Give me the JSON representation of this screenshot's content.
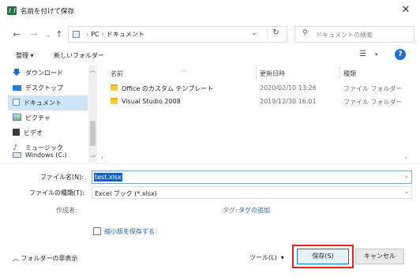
{
  "window": {
    "title": "名前を付けて保存",
    "close_glyph": "✕"
  },
  "address": {
    "breadcrumb": [
      "PC",
      "ドキュメント"
    ],
    "separator": "›",
    "search_placeholder": "ドキュメントの検索"
  },
  "toolbar": {
    "organize_label": "整理 ▾",
    "new_folder_label": "新しいフォルダー",
    "view_glyph": "☰",
    "help_glyph": "?"
  },
  "nav_pane": {
    "items": [
      {
        "label": "ダウンロード",
        "icon": "download-icon",
        "selected": false
      },
      {
        "label": "デスクトップ",
        "icon": "desktop-icon",
        "selected": false
      },
      {
        "label": "ドキュメント",
        "icon": "documents-icon",
        "selected": true
      },
      {
        "label": "ピクチャ",
        "icon": "pictures-icon",
        "selected": false
      },
      {
        "label": "ビデオ",
        "icon": "videos-icon",
        "selected": false
      },
      {
        "label": "ミュージック",
        "icon": "music-icon",
        "selected": false
      },
      {
        "label": "Windows (C:)",
        "icon": "drive-icon",
        "selected": false
      }
    ]
  },
  "file_list": {
    "columns": {
      "name": "名前",
      "date": "更新日時",
      "type": "種類"
    },
    "rows": [
      {
        "name": "Office のカスタム テンプレート",
        "date": "2020/02/10 13:26",
        "type": "ファイル フォルダー"
      },
      {
        "name": "Visual Studio 2008",
        "date": "2019/12/30 16:01",
        "type": "ファイル フォルダー"
      }
    ]
  },
  "form": {
    "filename_label": "ファイル名(N):",
    "filename_value": "test.xlsx",
    "filetype_label": "ファイルの種類(T):",
    "filetype_value": "Excel ブック (*.xlsx)",
    "author_label": "作成者:",
    "tags_label": "タグ:",
    "tags_link": "タグの追加",
    "thumbnail_label": "縮小版を保存する"
  },
  "footer": {
    "hide_folders_label": "フォルダーの非表示",
    "tools_label": "ツール(L)",
    "save_label": "保存(S)",
    "cancel_label": "キャンセル"
  },
  "colors": {
    "accent": "#0078d7",
    "highlight": "#e2231a",
    "selected_row": "#cce6f7",
    "link": "#1f5fbf"
  }
}
